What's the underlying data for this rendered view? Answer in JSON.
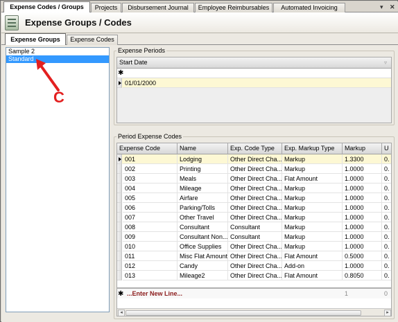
{
  "top_tabs": [
    "Expense Codes / Groups",
    "Projects",
    "Disbursement Journal",
    "Employee Reimbursables",
    "Automated Invoicing"
  ],
  "top_controls": {
    "dropdown": "▾",
    "close": "✕"
  },
  "header": {
    "title": "Expense Groups / Codes",
    "icon": "calculator-icon"
  },
  "sub_tabs": [
    "Expense Groups",
    "Expense Codes"
  ],
  "groups": [
    {
      "label": "Sample 2",
      "selected": false
    },
    {
      "label": "Standard",
      "selected": true
    }
  ],
  "expense_periods": {
    "title": "Expense Periods",
    "column": "Start Date",
    "new_row_marker": "✱",
    "rows": [
      {
        "start_date": "01/01/2000",
        "current": true
      }
    ]
  },
  "period_codes": {
    "title": "Period Expense Codes",
    "columns": [
      "Expense Code",
      "Name",
      "Exp. Code Type",
      "Exp. Markup Type",
      "Markup",
      "U"
    ],
    "rows": [
      {
        "code": "001",
        "name": "Lodging",
        "type": "Other Direct Cha...",
        "markup_type": "Markup",
        "markup": "1.3300",
        "u": "0.",
        "current": true
      },
      {
        "code": "002",
        "name": "Printing",
        "type": "Other Direct Cha...",
        "markup_type": "Markup",
        "markup": "1.0000",
        "u": "0."
      },
      {
        "code": "003",
        "name": "Meals",
        "type": "Other Direct Cha...",
        "markup_type": "Flat Amount",
        "markup": "1.0000",
        "u": "0."
      },
      {
        "code": "004",
        "name": "Mileage",
        "type": "Other Direct Cha...",
        "markup_type": "Markup",
        "markup": "1.0000",
        "u": "0."
      },
      {
        "code": "005",
        "name": "Airfare",
        "type": "Other Direct Cha...",
        "markup_type": "Markup",
        "markup": "1.0000",
        "u": "0."
      },
      {
        "code": "006",
        "name": "Parking/Tolls",
        "type": "Other Direct Cha...",
        "markup_type": "Markup",
        "markup": "1.0000",
        "u": "0."
      },
      {
        "code": "007",
        "name": "Other Travel",
        "type": "Other Direct Cha...",
        "markup_type": "Markup",
        "markup": "1.0000",
        "u": "0."
      },
      {
        "code": "008",
        "name": "Consultant",
        "type": "Consultant",
        "markup_type": "Markup",
        "markup": "1.0000",
        "u": "0."
      },
      {
        "code": "009",
        "name": "Consultant Non...",
        "type": "Consultant",
        "markup_type": "Markup",
        "markup": "1.0000",
        "u": "0."
      },
      {
        "code": "010",
        "name": "Office Supplies",
        "type": "Other Direct Cha...",
        "markup_type": "Markup",
        "markup": "1.0000",
        "u": "0."
      },
      {
        "code": "011",
        "name": "Misc Flat Amount",
        "type": "Other Direct Cha...",
        "markup_type": "Flat Amount",
        "markup": "0.5000",
        "u": "0."
      },
      {
        "code": "012",
        "name": "Candy",
        "type": "Other Direct Cha...",
        "markup_type": "Add-on",
        "markup": "1.0000",
        "u": "0."
      },
      {
        "code": "013",
        "name": "Mileage2",
        "type": "Other Direct Cha...",
        "markup_type": "Flat Amount",
        "markup": "0.8050",
        "u": "0."
      }
    ],
    "new_line": {
      "marker": "✱",
      "text": "...Enter New Line...",
      "markup": "1",
      "u": "0"
    }
  },
  "annotation": {
    "letter": "C",
    "color": "#e32020"
  }
}
